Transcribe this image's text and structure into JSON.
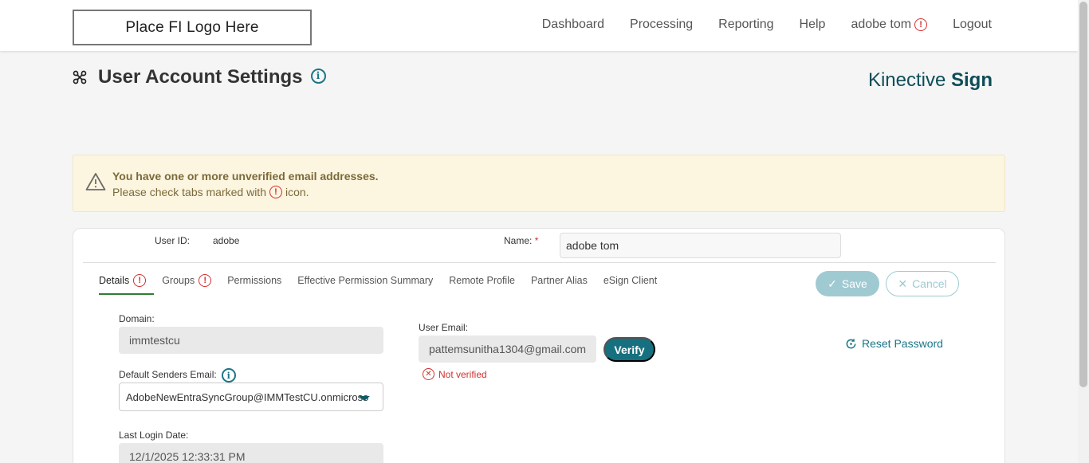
{
  "header": {
    "logo_text": "Place FI Logo Here",
    "nav": [
      "Dashboard",
      "Processing",
      "Reporting",
      "Help",
      "adobe tom",
      "Logout"
    ]
  },
  "page": {
    "title": "User Account Settings",
    "brand_light": "Kinective",
    "brand_bold": "Sign"
  },
  "warning": {
    "title": "You have one or more unverified email addresses.",
    "text_before": "Please check tabs marked with",
    "text_after": "icon."
  },
  "user": {
    "user_id_label": "User ID:",
    "user_id_value": "adobe",
    "name_label": "Name:",
    "name_required": "*",
    "name_value": "adobe tom"
  },
  "tabs": [
    {
      "label": "Details",
      "alert": true,
      "active": true
    },
    {
      "label": "Groups",
      "alert": true,
      "active": false
    },
    {
      "label": "Permissions",
      "alert": false,
      "active": false
    },
    {
      "label": "Effective Permission Summary",
      "alert": false,
      "active": false
    },
    {
      "label": "Remote Profile",
      "alert": false,
      "active": false
    },
    {
      "label": "Partner Alias",
      "alert": false,
      "active": false
    },
    {
      "label": "eSign Client",
      "alert": false,
      "active": false
    }
  ],
  "actions": {
    "save": "Save",
    "cancel": "Cancel"
  },
  "details": {
    "domain_label": "Domain:",
    "domain_value": "immtestcu",
    "senders_label": "Default Senders Email:",
    "senders_value": "AdobeNewEntraSyncGroup@IMMTestCU.onmicroso",
    "last_login_label": "Last Login Date:",
    "last_login_value": "12/1/2025 12:33:31 PM",
    "user_email_label": "User Email:",
    "user_email_value": "pattemsunitha1304@gmail.com",
    "verify_label": "Verify",
    "not_verified": "Not verified",
    "reset_password": "Reset Password"
  },
  "colors": {
    "accent": "#16707f",
    "error": "#d32f2f",
    "warning_bg": "#fcf5e0"
  }
}
